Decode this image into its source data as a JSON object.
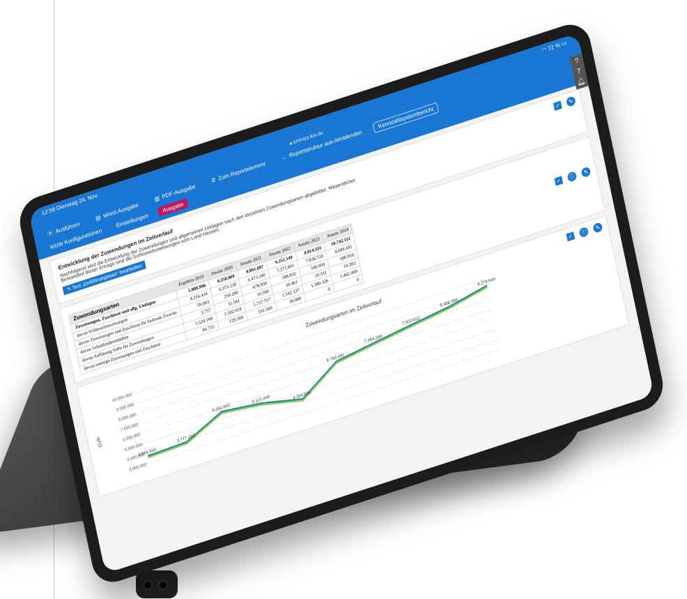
{
  "statusbar": {
    "time": "12:59",
    "date": "Dienstag 24. Nov.",
    "battery": "72 %"
  },
  "url": "primary.ikis.de",
  "toolbar": [
    {
      "icon": "play-icon",
      "label": "Ausführen"
    },
    {
      "icon": "word-icon",
      "label": "Word-Ausgabe"
    },
    {
      "icon": "pdf-icon",
      "label": "PDF-Ausgabe"
    },
    {
      "icon": "sort-icon",
      "label": "Zum Reportelement"
    },
    {
      "icon": "arrows-icon",
      "label": "Reportstruktur aus-/einblenden"
    },
    {
      "icon": "",
      "label": "Kennzahlsystembericht"
    }
  ],
  "tabs": [
    {
      "label": "letzte Konfigurationen"
    },
    {
      "label": "Einstellungen"
    },
    {
      "label": "Ausgabe"
    }
  ],
  "side_buttons": [
    "?",
    "7"
  ],
  "intro": {
    "title": "Entwicklung der Zuwendungen im Zeitverlauf",
    "text": "Nachfolgend wird die Entwicklung der Zuwendungen und allgemeinen Umlagen nach den einzelnen Zuwendungsarten abgebildet. Wesentlicher Bestandteil dieser Erträge sind die Schlüsselzuweisungen vom Land Hessen.",
    "edit_label": "Text „Einführungssatz“ bearbeiten"
  },
  "table": {
    "title": "Zuwendungsarten",
    "headers": [
      "Ergebnis 2019",
      "Ansatz 2020",
      "Ansatz 2021",
      "Ansatz 2022",
      "Ansatz 2023",
      "Ansatz 2024"
    ],
    "rows": [
      {
        "label": "Zuweisungen, Zuschüsse und allg. Umlagen",
        "values": [
          "5.888.996",
          "8.258.069",
          "8.891.097",
          "9.252.149",
          "8.814.331",
          "10.742.112"
        ],
        "bold": true
      },
      {
        "label": "davon Schlüsselzuweisungen",
        "values": [
          "4.216.434",
          "6.373.230",
          "6.473.240",
          "7.271.601",
          "7.836.724",
          "8.699.491"
        ],
        "bold": false
      },
      {
        "label": "davon Zuweisungen und Zuschüsse für laufende Zwecke",
        "values": [
          "59.883",
          "250.200",
          "678.950",
          "588.950",
          "588.950",
          "588.950"
        ],
        "bold": false
      },
      {
        "label": "davon Schuldendiensthilfen",
        "values": [
          "3.757",
          "11.541",
          "10.590",
          "10.461",
          "10.331",
          "10.202"
        ],
        "bold": false
      },
      {
        "label": "davon Auflösung SoPo für Zuwendungen",
        "values": [
          "1.524.168",
          "1.502.618",
          "1.737.717",
          "1.542.137",
          "1.380.326",
          "1.462.469"
        ],
        "bold": false
      },
      {
        "label": "davon sonstige Zuweisungen und Zuschüsse",
        "values": [
          "84.755",
          "120.500",
          "191.500",
          "39.000",
          "0",
          "0"
        ],
        "bold": false
      }
    ]
  },
  "chart_data": {
    "type": "line",
    "title": "Zuwendungsarten im Zeitverlauf",
    "ylabel": "EUR",
    "yticks": [
      "10.000.000",
      "9.000.000",
      "8.000.000",
      "7.000.000",
      "6.000.000",
      "5.000.000",
      "4.000.000",
      "3.000.000"
    ],
    "ylim": [
      3000000,
      10000000
    ],
    "points": [
      3644916,
      3777152,
      5551502,
      5121448,
      4264828,
      6758451,
      7354280,
      7910012,
      8456005,
      9279643
    ],
    "labels": [
      "3.644.916",
      "3.777.152",
      "5.551.502",
      "5.121.448",
      "4.264.828",
      "6.758.451",
      "7.354.280",
      "7.910.012",
      "8.456.005",
      "9.279.643"
    ],
    "series": [
      {
        "color": "#2e7d32"
      },
      {
        "color": "#29b6f6"
      },
      {
        "color": "#c0ca33"
      }
    ]
  },
  "colors": {
    "accent": "#1976d2",
    "active_tab": "#c2185b"
  }
}
